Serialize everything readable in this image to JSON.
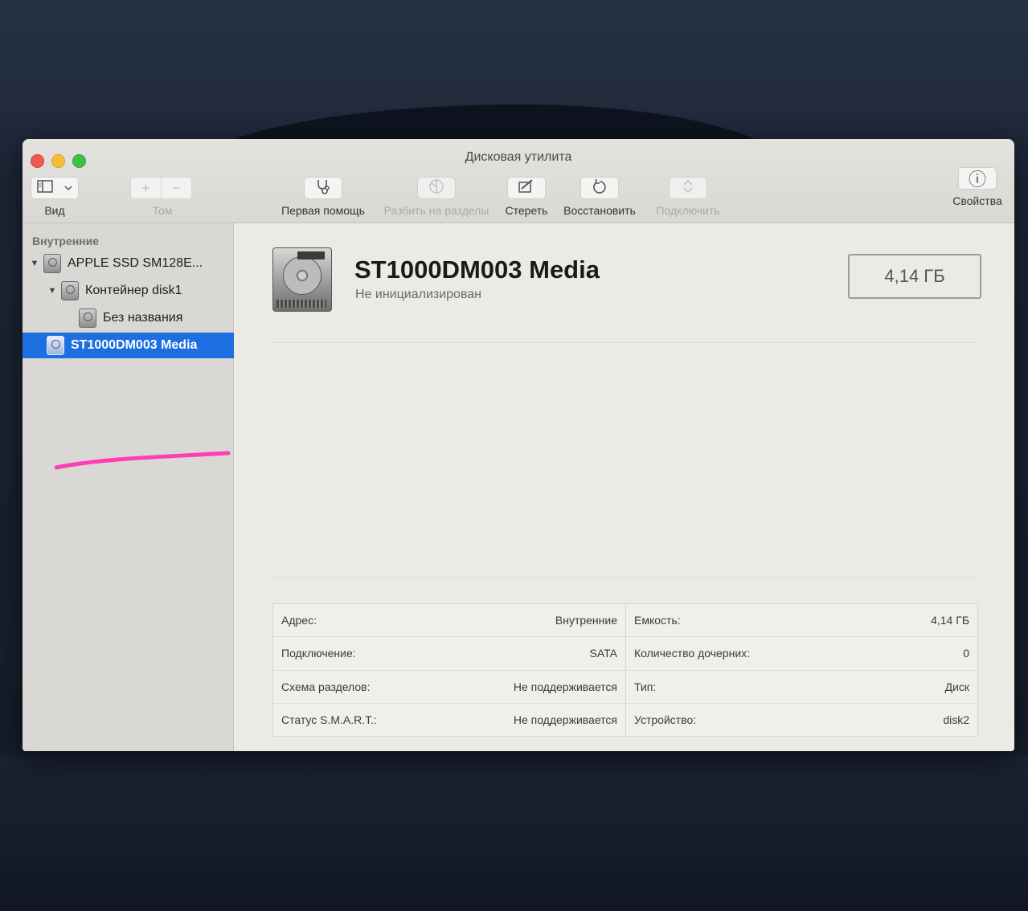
{
  "window": {
    "title": "Дисковая утилита"
  },
  "toolbar": {
    "view_label": "Вид",
    "volume_label": "Том",
    "first_aid_label": "Первая помощь",
    "partition_label": "Разбить на разделы",
    "erase_label": "Стереть",
    "restore_label": "Восстановить",
    "mount_label": "Подключить",
    "info_label": "Свойства",
    "volume_add_symbol": "+",
    "volume_remove_symbol": "−",
    "info_symbol": "ⓘ"
  },
  "sidebar": {
    "section_title": "Внутренние",
    "items": [
      {
        "label": "APPLE SSD SM128E...",
        "icon": "internal-disk-icon",
        "expanded": true
      },
      {
        "label": "Контейнер disk1",
        "icon": "container-disk-icon",
        "expanded": true
      },
      {
        "label": "Без названия",
        "icon": "volume-disk-icon"
      },
      {
        "label": "ST1000DM003 Media",
        "icon": "hard-drive-icon",
        "selected": true
      }
    ]
  },
  "detail": {
    "name": "ST1000DM003 Media",
    "status": "Не инициализирован",
    "capacity": "4,14 ГБ",
    "info_left": [
      {
        "key": "Адрес:",
        "value": "Внутренние"
      },
      {
        "key": "Подключение:",
        "value": "SATA"
      },
      {
        "key": "Схема разделов:",
        "value": "Не поддерживается"
      },
      {
        "key": "Статус S.M.A.R.T.:",
        "value": "Не поддерживается"
      }
    ],
    "info_right": [
      {
        "key": "Емкость:",
        "value": "4,14 ГБ"
      },
      {
        "key": "Количество дочерних:",
        "value": "0"
      },
      {
        "key": "Тип:",
        "value": "Диск"
      },
      {
        "key": "Устройство:",
        "value": "disk2"
      }
    ]
  },
  "colors": {
    "selection": "#1d6ee0",
    "annotation_stroke": "#ff3db5"
  }
}
